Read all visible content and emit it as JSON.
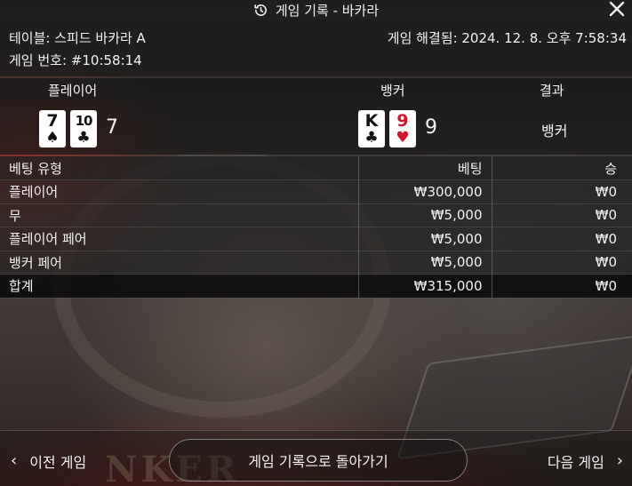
{
  "title": "게임 기록 - 바카라",
  "info": {
    "table": "테이블: 스피드 바카라 A",
    "game_number": "게임 번호: #10:58:14",
    "resolved": "게임 해결됨: 2024. 12. 8. 오후 7:58:34"
  },
  "result": {
    "headers": {
      "player": "플레이어",
      "banker": "뱅커",
      "outcome": "결과"
    },
    "player_cards": [
      {
        "rank": "7",
        "suit": "♠"
      },
      {
        "rank": "10",
        "suit": "♣"
      }
    ],
    "player_score": "7",
    "banker_cards": [
      {
        "rank": "K",
        "suit": "♣"
      },
      {
        "rank": "9",
        "suit": "♥"
      }
    ],
    "banker_score": "9",
    "outcome": "뱅커"
  },
  "bets": {
    "headers": {
      "type": "베팅 유형",
      "bet": "베팅",
      "win": "승"
    },
    "rows": [
      {
        "type": "플레이어",
        "bet": "₩300,000",
        "win": "₩0"
      },
      {
        "type": "무",
        "bet": "₩5,000",
        "win": "₩0"
      },
      {
        "type": "플레이어 페어",
        "bet": "₩5,000",
        "win": "₩0"
      },
      {
        "type": "뱅커 페어",
        "bet": "₩5,000",
        "win": "₩0"
      }
    ],
    "total": {
      "type": "합계",
      "bet": "₩315,000",
      "win": "₩0"
    }
  },
  "footer": {
    "prev": "이전 게임",
    "back": "게임 기록으로 돌아가기",
    "next": "다음 게임"
  },
  "icons": {
    "title": "history-icon",
    "close": "close-icon",
    "prev": "chevron-left-icon",
    "next": "chevron-right-icon"
  },
  "colors": {
    "heart": "#d4142a",
    "card": "#ffffff"
  }
}
